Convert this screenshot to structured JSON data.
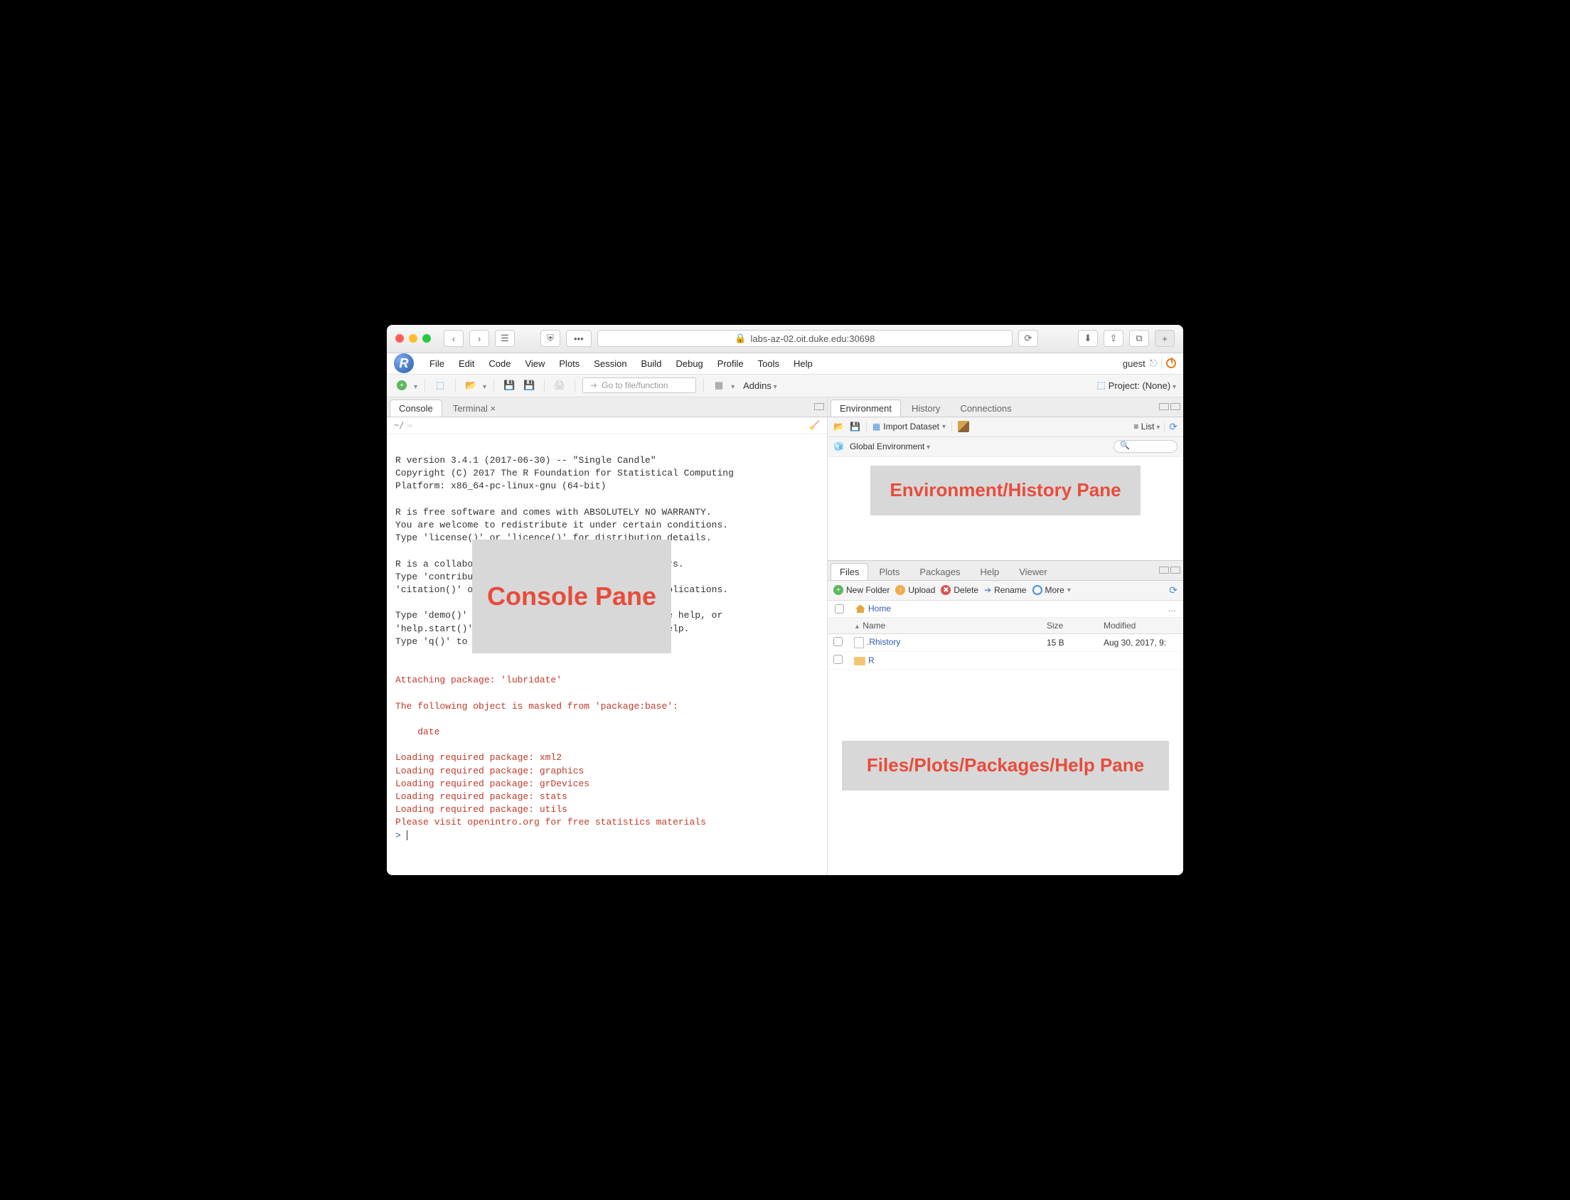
{
  "browser": {
    "url": "labs-az-02.oit.duke.edu:30698"
  },
  "menu": {
    "items": [
      "File",
      "Edit",
      "Code",
      "View",
      "Plots",
      "Session",
      "Build",
      "Debug",
      "Profile",
      "Tools",
      "Help"
    ],
    "user": "guest"
  },
  "toolbar": {
    "goto_placeholder": "Go to file/function",
    "addins": "Addins",
    "project": "Project: (None)"
  },
  "console": {
    "tab_console": "Console",
    "tab_terminal": "Terminal",
    "path": "~/",
    "lines_plain": "R version 3.4.1 (2017-06-30) -- \"Single Candle\"\nCopyright (C) 2017 The R Foundation for Statistical Computing\nPlatform: x86_64-pc-linux-gnu (64-bit)\n\nR is free software and comes with ABSOLUTELY NO WARRANTY.\nYou are welcome to redistribute it under certain conditions.\nType 'license()' or 'licence()' for distribution details.\n\nR is a collabo                                   rs.\nType 'contribu                                   \n'citation()' o                                   plications.\n\nType 'demo()'                                    e help, or\n'help.start()'                                   elp.\nType 'q()' to \n\n",
    "lines_red": "Attaching package: 'lubridate'\n\nThe following object is masked from 'package:base':\n\n    date\n\nLoading required package: xml2\nLoading required package: graphics\nLoading required package: grDevices\nLoading required package: stats\nLoading required package: utils\nPlease visit openintro.org for free statistics materials",
    "prompt": "> "
  },
  "env": {
    "tab_env": "Environment",
    "tab_history": "History",
    "tab_conn": "Connections",
    "import": "Import Dataset",
    "scope": "Global Environment",
    "list": "List"
  },
  "files": {
    "tab_files": "Files",
    "tab_plots": "Plots",
    "tab_packages": "Packages",
    "tab_help": "Help",
    "tab_viewer": "Viewer",
    "newfolder": "New Folder",
    "upload": "Upload",
    "delete": "Delete",
    "rename": "Rename",
    "more": "More",
    "home": "Home",
    "col_name": "Name",
    "col_size": "Size",
    "col_modified": "Modified",
    "rows": [
      {
        "name": ".Rhistory",
        "size": "15 B",
        "modified": "Aug 30, 2017, 9:",
        "type": "file"
      },
      {
        "name": "R",
        "size": "",
        "modified": "",
        "type": "folder"
      }
    ]
  },
  "overlays": {
    "console": "Console Pane",
    "env": "Environment/History Pane",
    "files": "Files/Plots/Packages/Help Pane"
  }
}
